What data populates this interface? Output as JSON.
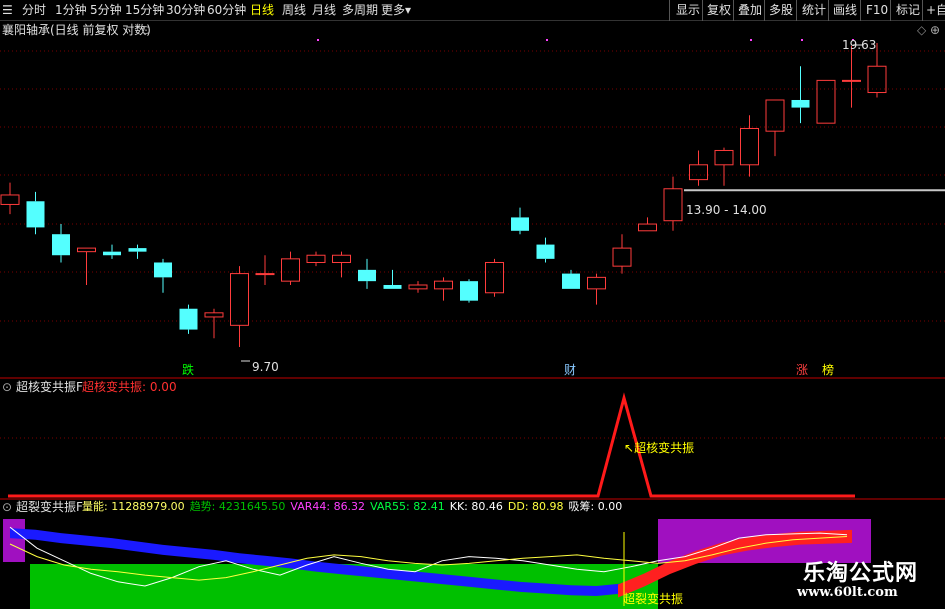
{
  "toolbar": {
    "periods": [
      "分时",
      "1分钟",
      "5分钟",
      "15分钟",
      "30分钟",
      "60分钟",
      "日线",
      "周线",
      "月线",
      "多周期",
      "更多"
    ],
    "active_period": "日线",
    "more_arrow": "▾",
    "right_buttons": [
      "显示",
      "复权",
      "叠加",
      "多股",
      "统计",
      "画线",
      "F10",
      "标记",
      "+自"
    ]
  },
  "main_panel": {
    "title": "襄阳轴承(日线 前复权 对数)",
    "high_label": "19.63",
    "low_label": "9.70",
    "range_label": "13.90 - 14.00",
    "signals": {
      "die": "跌",
      "cai": "财",
      "zhang": "涨",
      "bang": "榜"
    }
  },
  "panel2": {
    "name": "超核变共振F",
    "value_label": "超核变共振: 0.00",
    "peak_label": "超核变共振"
  },
  "panel3": {
    "name": "超裂变共振F",
    "readouts": [
      {
        "text": "量能: 11288979.00",
        "color": "#ffff66"
      },
      {
        "text": "趋势: 4231645.50",
        "color": "#00c000"
      },
      {
        "text": "VAR44: 86.32",
        "color": "#ff40ff"
      },
      {
        "text": "VAR55: 82.41",
        "color": "#00ff40"
      },
      {
        "text": "KK: 80.46",
        "color": "#ffffff"
      },
      {
        "text": "DD: 80.98",
        "color": "#ffff40"
      },
      {
        "text": "吸筹: 0.00",
        "color": "#ffffff"
      }
    ],
    "bottom_label": "超裂变共振"
  },
  "watermark": {
    "logo": "乐淘公式网",
    "url": "www.60lt.com"
  },
  "chart_data": {
    "type": "candlestick",
    "candles": [
      {
        "o": 13.5,
        "h": 14.2,
        "l": 13.2,
        "c": 13.8
      },
      {
        "o": 13.6,
        "h": 13.9,
        "l": 12.6,
        "c": 12.8
      },
      {
        "o": 12.6,
        "h": 12.9,
        "l": 11.8,
        "c": 12.0
      },
      {
        "o": 12.1,
        "h": 12.2,
        "l": 11.2,
        "c": 12.2
      },
      {
        "o": 12.1,
        "h": 12.3,
        "l": 11.9,
        "c": 12.0
      },
      {
        "o": 12.2,
        "h": 12.3,
        "l": 11.9,
        "c": 12.1
      },
      {
        "o": 11.8,
        "h": 11.9,
        "l": 11.0,
        "c": 11.4
      },
      {
        "o": 10.6,
        "h": 10.7,
        "l": 10.0,
        "c": 10.1
      },
      {
        "o": 10.4,
        "h": 10.6,
        "l": 9.9,
        "c": 10.5
      },
      {
        "o": 10.2,
        "h": 11.7,
        "l": 9.7,
        "c": 11.5
      },
      {
        "o": 11.5,
        "h": 12.0,
        "l": 11.2,
        "c": 11.5
      },
      {
        "o": 11.3,
        "h": 12.1,
        "l": 11.2,
        "c": 11.9
      },
      {
        "o": 11.8,
        "h": 12.1,
        "l": 11.7,
        "c": 12.0
      },
      {
        "o": 11.8,
        "h": 12.1,
        "l": 11.4,
        "c": 12.0
      },
      {
        "o": 11.6,
        "h": 11.9,
        "l": 11.1,
        "c": 11.3
      },
      {
        "o": 11.2,
        "h": 11.6,
        "l": 11.1,
        "c": 11.1
      },
      {
        "o": 11.1,
        "h": 11.3,
        "l": 11.0,
        "c": 11.2
      },
      {
        "o": 11.1,
        "h": 11.4,
        "l": 10.8,
        "c": 11.3
      },
      {
        "o": 11.3,
        "h": 11.35,
        "l": 10.75,
        "c": 10.8
      },
      {
        "o": 11.0,
        "h": 11.9,
        "l": 10.9,
        "c": 11.8
      },
      {
        "o": 13.1,
        "h": 13.4,
        "l": 12.6,
        "c": 12.7
      },
      {
        "o": 12.3,
        "h": 12.5,
        "l": 11.8,
        "c": 11.9
      },
      {
        "o": 11.5,
        "h": 11.6,
        "l": 11.1,
        "c": 11.1
      },
      {
        "o": 11.1,
        "h": 11.5,
        "l": 10.7,
        "c": 11.4
      },
      {
        "o": 11.7,
        "h": 12.6,
        "l": 11.5,
        "c": 12.2
      },
      {
        "o": 12.7,
        "h": 13.1,
        "l": 12.7,
        "c": 12.9
      },
      {
        "o": 13.0,
        "h": 14.4,
        "l": 12.7,
        "c": 14.0
      },
      {
        "o": 14.3,
        "h": 15.3,
        "l": 14.1,
        "c": 14.8
      },
      {
        "o": 14.8,
        "h": 15.4,
        "l": 14.1,
        "c": 15.3
      },
      {
        "o": 14.8,
        "h": 16.6,
        "l": 14.4,
        "c": 16.1
      },
      {
        "o": 16.0,
        "h": 17.2,
        "l": 15.1,
        "c": 17.2
      },
      {
        "o": 17.2,
        "h": 18.6,
        "l": 16.3,
        "c": 16.9
      },
      {
        "o": 16.3,
        "h": 18.0,
        "l": 16.3,
        "c": 18.0
      },
      {
        "o": 18.0,
        "h": 19.5,
        "l": 16.9,
        "c": 18.0
      },
      {
        "o": 17.5,
        "h": 19.63,
        "l": 17.3,
        "c": 18.6
      }
    ],
    "panel2_values": [
      0,
      0,
      0,
      0,
      0,
      0,
      0,
      0,
      0,
      0,
      0,
      0,
      0,
      0,
      0,
      0,
      0,
      0,
      0,
      0,
      0,
      0,
      0,
      0,
      1,
      0,
      0,
      0,
      0,
      0,
      0,
      0,
      0,
      0
    ],
    "bands": {
      "blue": [
        88,
        86,
        82,
        79,
        76,
        72,
        68,
        65,
        62,
        58,
        55,
        52,
        48,
        45,
        42,
        39,
        36,
        33,
        30,
        27,
        24,
        22,
        20,
        19,
        22
      ],
      "red": [
        22,
        35,
        50,
        62,
        72,
        78,
        82,
        85,
        86,
        87
      ]
    },
    "lines": {
      "white": [
        95,
        70,
        55,
        40,
        30,
        25,
        35,
        48,
        55,
        45,
        38,
        50,
        60,
        52,
        45,
        42,
        55,
        60,
        58,
        55,
        50,
        45,
        42,
        48,
        55,
        60,
        70,
        82,
        86,
        87,
        88,
        86
      ],
      "yellow": [
        75,
        60,
        50,
        45,
        42,
        38,
        35,
        32,
        35,
        42,
        50,
        58,
        62,
        60,
        55,
        52,
        50,
        52,
        55,
        58,
        60,
        62,
        58,
        55,
        52,
        55,
        62,
        70,
        76,
        80,
        82,
        84
      ]
    },
    "ylabel": ""
  }
}
